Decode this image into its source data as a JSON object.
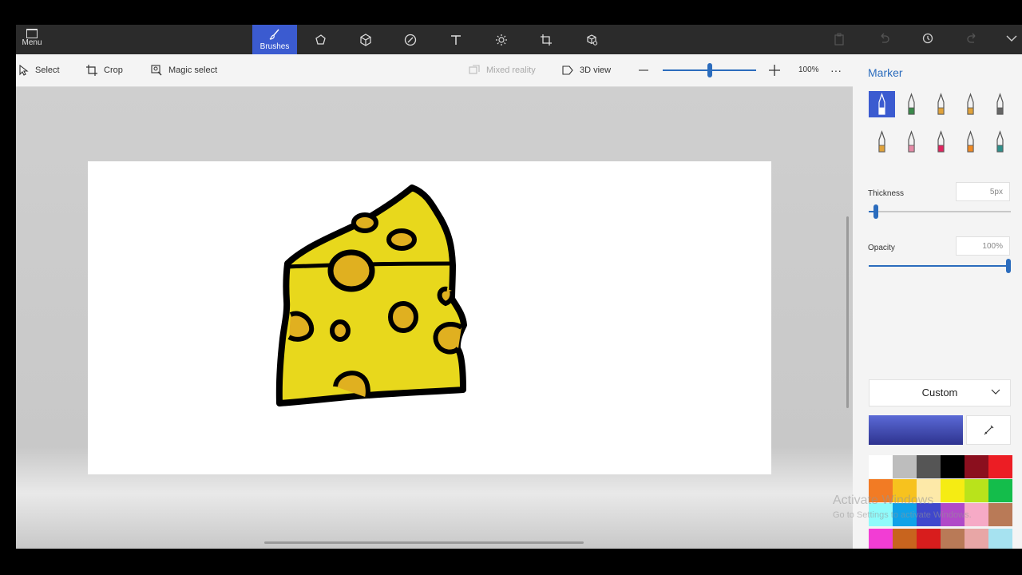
{
  "titlebar": {
    "menu_label": "Menu",
    "active_tool_label": "Brushes",
    "tools": [
      {
        "name": "brushes-icon"
      },
      {
        "name": "2d-shapes-icon"
      },
      {
        "name": "3d-shapes-icon"
      },
      {
        "name": "stickers-icon"
      },
      {
        "name": "text-icon"
      },
      {
        "name": "effects-icon"
      },
      {
        "name": "canvas-icon"
      },
      {
        "name": "3d-library-icon"
      }
    ]
  },
  "toolbar": {
    "select_label": "Select",
    "crop_label": "Crop",
    "magic_select_label": "Magic select",
    "mixed_reality_label": "Mixed reality",
    "view3d_label": "3D view",
    "zoom_value": "100%",
    "zoom_level": 0.5,
    "more_label": "···"
  },
  "panel": {
    "title": "Marker",
    "brushes": [
      {
        "name": "marker-brush",
        "color": "#ffffff"
      },
      {
        "name": "calligraphy-pen",
        "color": "#3a8a4a"
      },
      {
        "name": "oil-brush",
        "color": "#e0a23a"
      },
      {
        "name": "watercolor",
        "color": "#e0a23a"
      },
      {
        "name": "pixel-pen",
        "color": "#666666"
      },
      {
        "name": "pencil",
        "color": "#e0a23a"
      },
      {
        "name": "eraser",
        "color": "#e58aa6"
      },
      {
        "name": "crayon",
        "color": "#e0245e"
      },
      {
        "name": "spray-can",
        "color": "#f08a24"
      },
      {
        "name": "fill",
        "color": "#2f8f8a"
      }
    ],
    "thickness_label": "Thickness",
    "thickness_value": "5px",
    "thickness_level": 0.05,
    "opacity_label": "Opacity",
    "opacity_value": "100%",
    "opacity_level": 1.0,
    "color_mode": "Custom",
    "current_color": "#3f47b5",
    "palette": [
      "#ffffff",
      "#bdbdbd",
      "#555555",
      "#000000",
      "#8b0f1e",
      "#ec1d24",
      "#f27b24",
      "#f7c21e",
      "#fde9a8",
      "#f5ec13",
      "#b9e31b",
      "#14bd4b",
      "#8ffbfb",
      "#10a2e8",
      "#3f47cc",
      "#b04ac8",
      "#f6aac6",
      "#b97a57",
      "#f23dd4",
      "#c8641e",
      "#d81d1d",
      "#b97a57",
      "#e8a6a6",
      "#a6e2f0"
    ]
  },
  "watermark": {
    "line1": "Activate Windows",
    "line2": "Go to Settings to activate Windows."
  }
}
